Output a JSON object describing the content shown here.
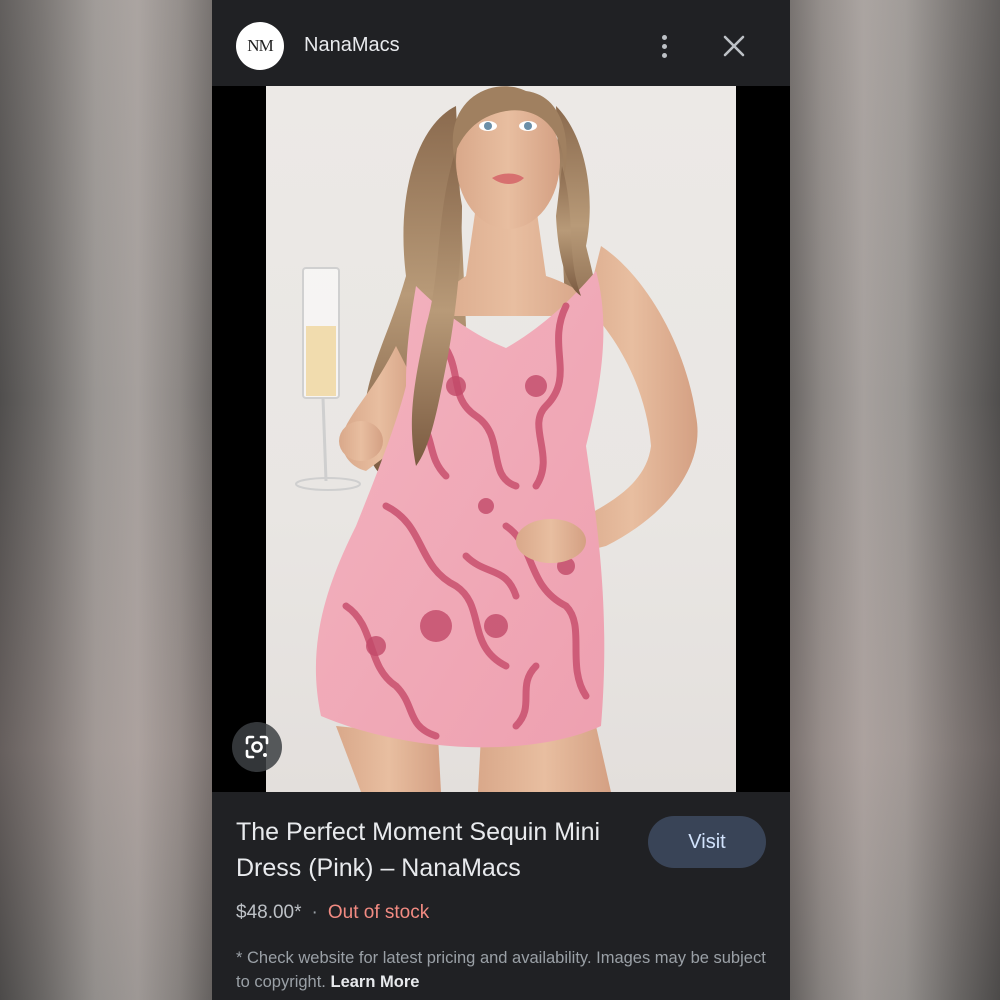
{
  "header": {
    "logo_text": "NM",
    "site_name": "NanaMacs",
    "more_icon": "more-vert-icon",
    "close_icon": "close-icon"
  },
  "image": {
    "lens_icon": "google-lens-icon"
  },
  "product": {
    "title": "The Perfect Moment Sequin Mini Dress (Pink) – NanaMacs",
    "visit_label": "Visit",
    "price": "$48.00*",
    "separator": "·",
    "stock_status": "Out of stock",
    "disclaimer": "* Check website for latest pricing and availability. Images may be subject to copyright.",
    "learn_more": "Learn More"
  },
  "colors": {
    "panel_bg": "#202124",
    "visit_bg": "#394457",
    "visit_text": "#d2e3fc",
    "out_of_stock": "#f28b82",
    "dress_pink": "#f0a3b2"
  }
}
